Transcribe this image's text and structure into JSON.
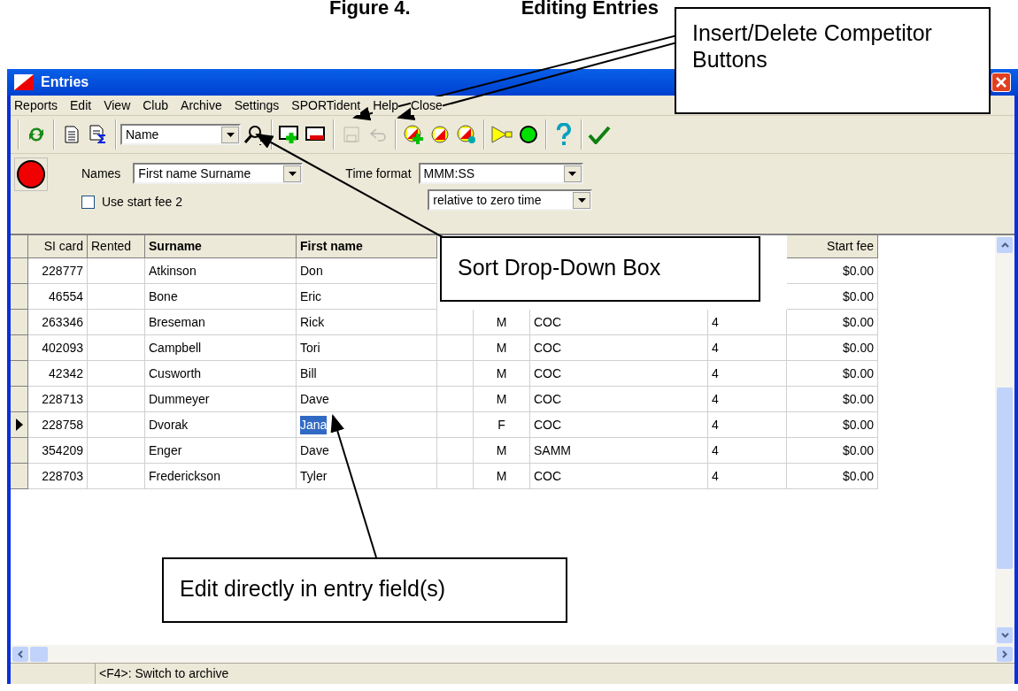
{
  "figure_title": {
    "number": "Figure 4.",
    "caption": "Editing Entries"
  },
  "window": {
    "title": "Entries"
  },
  "menu": [
    "Reports",
    "Edit",
    "View",
    "Club",
    "Archive",
    "Settings",
    "SPORTident",
    "Help",
    "Close"
  ],
  "toolbar": {
    "sort_field": "Name"
  },
  "options": {
    "names_label": "Names",
    "names_value": "First name Surname",
    "time_format_label": "Time format",
    "time_format_value": "MMM:SS",
    "time_reference_value": "relative to zero time",
    "start_fee_2": {
      "label": "Use start fee 2",
      "checked": false
    }
  },
  "table": {
    "columns": [
      "SI card",
      "Rented",
      "Surname",
      "First name",
      null,
      null,
      null,
      null,
      "Start fee"
    ],
    "rows": [
      {
        "selected": false,
        "cells": [
          "228777",
          "",
          "Atkinson",
          "Don",
          null,
          null,
          null,
          null,
          "$0.00"
        ]
      },
      {
        "selected": false,
        "cells": [
          "46554",
          "",
          "Bone",
          "Eric",
          null,
          null,
          null,
          null,
          "$0.00"
        ]
      },
      {
        "selected": false,
        "cells": [
          "263346",
          "",
          "Breseman",
          "Rick",
          "",
          "M",
          "COC",
          "4",
          "$0.00"
        ]
      },
      {
        "selected": false,
        "cells": [
          "402093",
          "",
          "Campbell",
          "Tori",
          "",
          "M",
          "COC",
          "4",
          "$0.00"
        ]
      },
      {
        "selected": false,
        "cells": [
          "42342",
          "",
          "Cusworth",
          "Bill",
          "",
          "M",
          "COC",
          "4",
          "$0.00"
        ]
      },
      {
        "selected": false,
        "cells": [
          "228713",
          "",
          "Dummeyer",
          "Dave",
          "",
          "M",
          "COC",
          "4",
          "$0.00"
        ]
      },
      {
        "selected": true,
        "cells": [
          "228758",
          "",
          "Dvorak",
          {
            "text": "Jana",
            "selected": true
          },
          "",
          "F",
          "COC",
          "4",
          "$0.00"
        ]
      },
      {
        "selected": false,
        "cells": [
          "354209",
          "",
          "Enger",
          "Dave",
          "",
          "M",
          "SAMM",
          "4",
          "$0.00"
        ]
      },
      {
        "selected": false,
        "cells": [
          "228703",
          "",
          "Frederickson",
          "Tyler",
          "",
          "M",
          "COC",
          "4",
          "$0.00"
        ]
      }
    ]
  },
  "status_bar": {
    "hint": "<F4>: Switch to archive"
  },
  "callouts": [
    {
      "kind": "toolbar",
      "text": "Insert/Delete Competitor Buttons"
    },
    {
      "kind": "sort",
      "text": "Sort Drop-Down Box"
    },
    {
      "kind": "edit",
      "text": "Edit directly in entry field(s)"
    }
  ]
}
